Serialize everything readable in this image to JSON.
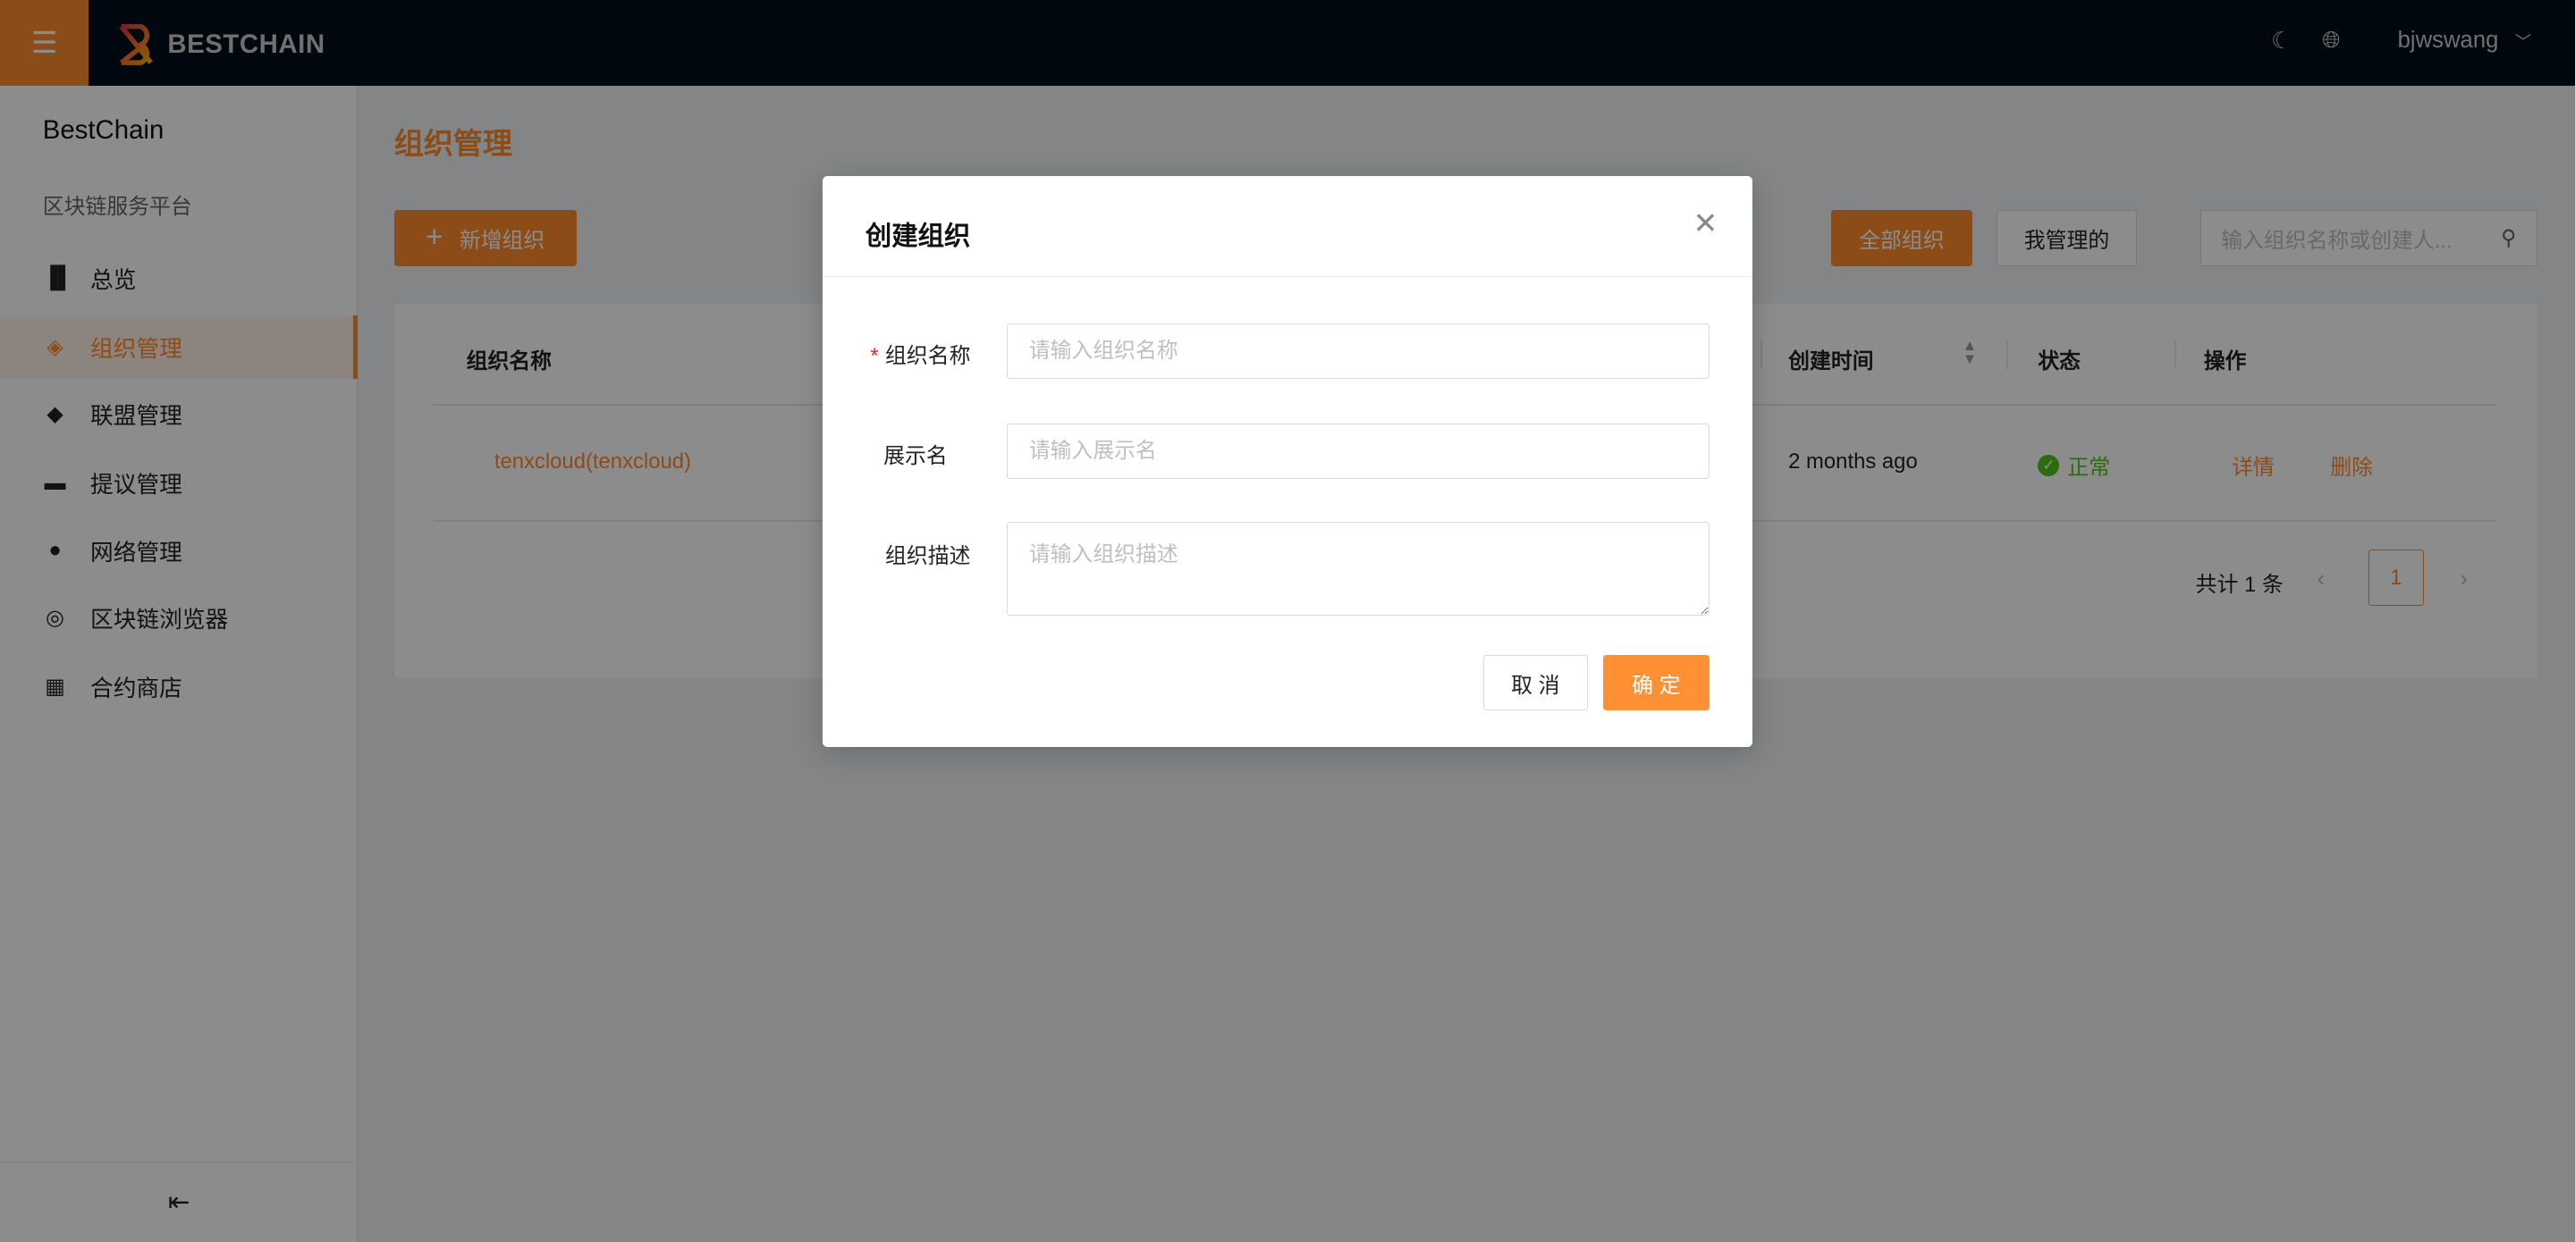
{
  "header": {
    "brand": "BESTCHAIN",
    "user": "bjwswang",
    "icons": [
      "menu-icon",
      "moon-icon",
      "globe-icon",
      "chevron-down-icon"
    ]
  },
  "sidebar": {
    "title": "BestChain",
    "subtitle": "区块链服务平台",
    "items": [
      {
        "label": "总览",
        "icon": "bar-chart-icon"
      },
      {
        "label": "组织管理",
        "icon": "layers-icon",
        "active": true
      },
      {
        "label": "联盟管理",
        "icon": "cube-icon"
      },
      {
        "label": "提议管理",
        "icon": "inbox-icon"
      },
      {
        "label": "网络管理",
        "icon": "planet-icon"
      },
      {
        "label": "区块链浏览器",
        "icon": "chrome-icon"
      },
      {
        "label": "合约商店",
        "icon": "shop-icon"
      }
    ]
  },
  "main": {
    "title": "组织管理",
    "add_button": "新增组织",
    "filter_all": "全部组织",
    "filter_mine": "我管理的",
    "search_placeholder": "输入组织名称或创建人...",
    "table": {
      "columns": [
        "组织名称",
        "创建时间",
        "状态",
        "操作"
      ],
      "rows": [
        {
          "name": "tenxcloud(tenxcloud)",
          "created": "2 months ago",
          "status": "正常",
          "actions": [
            "详情",
            "删除"
          ]
        }
      ]
    },
    "pagination": {
      "total": "共计 1 条",
      "current": "1"
    }
  },
  "modal": {
    "title": "创建组织",
    "fields": [
      {
        "label": "组织名称",
        "placeholder": "请输入组织名称",
        "required": true
      },
      {
        "label": "展示名",
        "placeholder": "请输入展示名"
      },
      {
        "label": "组织描述",
        "placeholder": "请输入组织描述"
      }
    ],
    "cancel": "取 消",
    "confirm": "确 定"
  },
  "colors": {
    "accent": "#ff8a2a",
    "header": "#000e1a",
    "success": "#52c41a",
    "overlay": "rgba(0,0,0,0.45)"
  }
}
